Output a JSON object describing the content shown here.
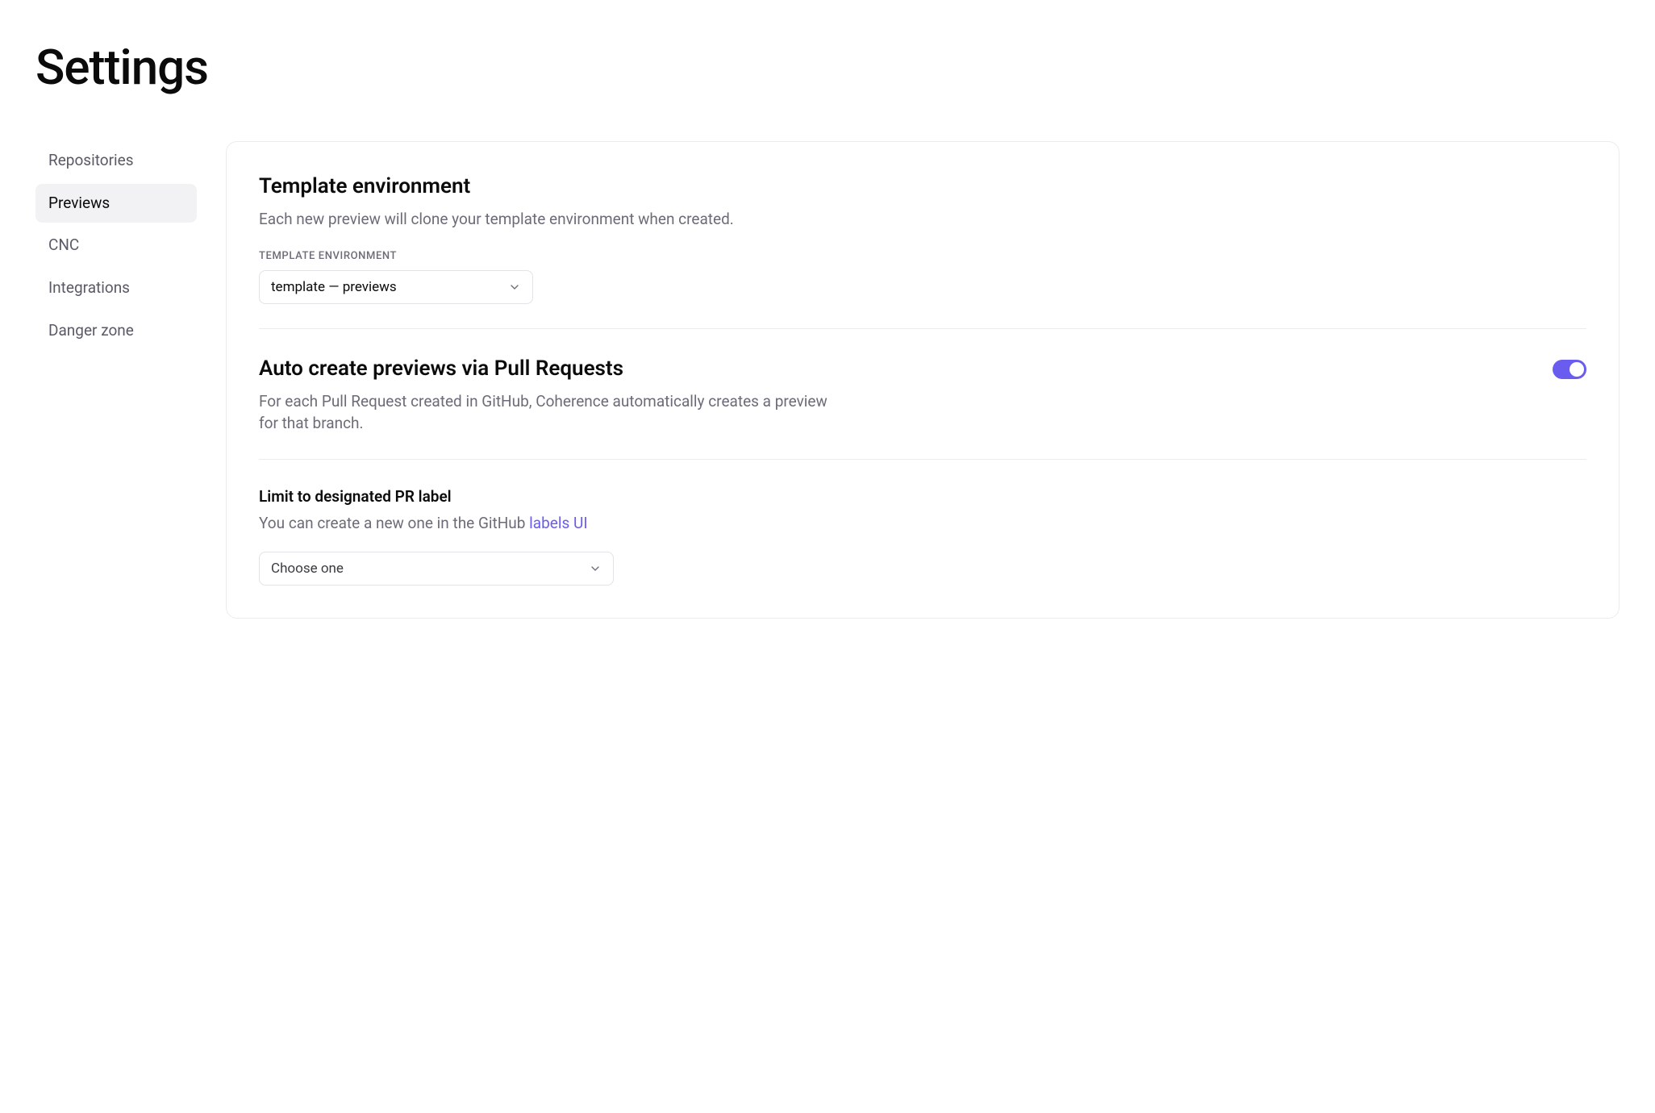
{
  "page": {
    "title": "Settings"
  },
  "sidebar": {
    "items": [
      {
        "label": "Repositories",
        "active": false
      },
      {
        "label": "Previews",
        "active": true
      },
      {
        "label": "CNC",
        "active": false
      },
      {
        "label": "Integrations",
        "active": false
      },
      {
        "label": "Danger zone",
        "active": false
      }
    ]
  },
  "sections": {
    "template_env": {
      "title": "Template environment",
      "description": "Each new preview will clone your template environment when created.",
      "field_label": "TEMPLATE ENVIRONMENT",
      "select_value": "template — previews"
    },
    "auto_create": {
      "title": "Auto create previews via Pull Requests",
      "description": "For each Pull Request created in GitHub, Coherence automatically creates a preview for that branch.",
      "toggle_on": true
    },
    "pr_label": {
      "title": "Limit to designated PR label",
      "desc_prefix": "You can create a new one in the GitHub ",
      "link_text": "labels UI",
      "select_value": "Choose one"
    }
  }
}
